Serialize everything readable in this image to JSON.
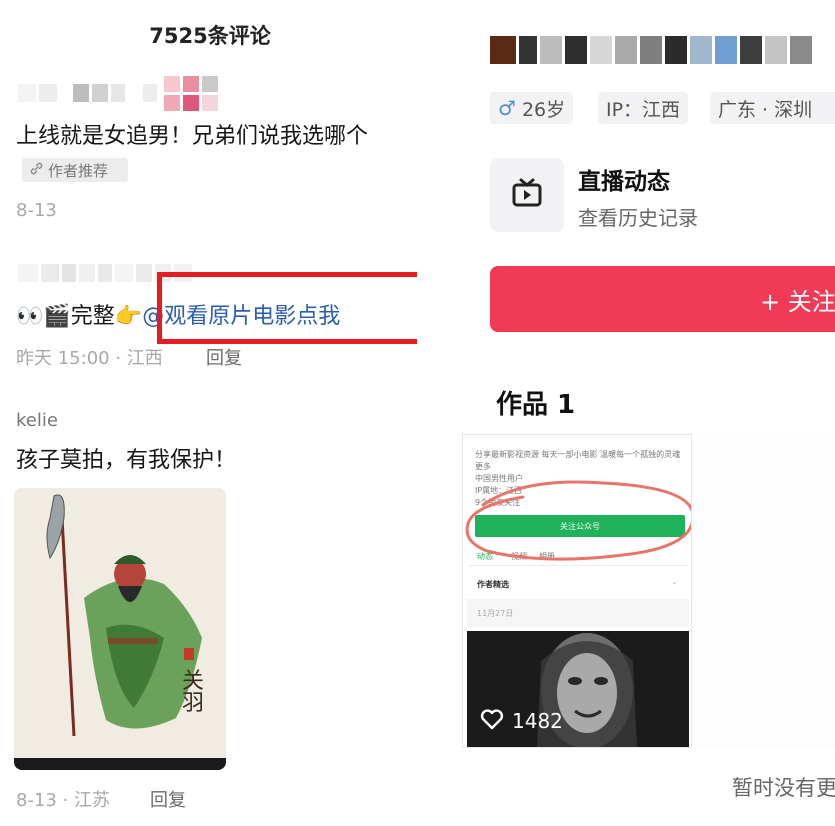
{
  "left": {
    "comment_count_title": "7525条评论",
    "comments": [
      {
        "text": "上线就是女追男！兄弟们说我选哪个",
        "badge": "作者推荐",
        "meta": "8-13"
      },
      {
        "emoji": "👀🎬",
        "text_prefix": "完整",
        "pointer_emoji": "👉",
        "mention": "@观看原片电影点我",
        "meta": "昨天 15:00 · 江西",
        "reply": "回复"
      },
      {
        "username": "kelie",
        "text": "孩子莫拍，有我保护！",
        "meta": "8-13 · 江苏",
        "reply": "回复"
      }
    ]
  },
  "right": {
    "tags": {
      "gender_age": "26岁",
      "ip": "IP：江西",
      "location": "广东 · 深圳"
    },
    "live": {
      "title": "直播动态",
      "subtitle": "查看历史记录"
    },
    "follow_label": "+ 关注",
    "works_title": "作品 1",
    "thumbnail": {
      "line1": "分享最新影视资源 每天一部小电影 温暖每一个孤独的灵魂",
      "line2": "更多",
      "line3": "中国男性用户",
      "line4": "IP属地：江西",
      "line5": "9个朋友关注",
      "green_button": "关注公众号",
      "tab1": "动态",
      "tab2": "视频",
      "tab3": "相册",
      "section": "作者精选",
      "date": "11月27日",
      "likes": "1482"
    },
    "empty_text": "暂时没有更多了"
  },
  "colors": {
    "follow_red": "#f13a56",
    "highlight_box": "#e51d20",
    "mention_blue": "#2a5db0",
    "annotation_circle": "#e8746a",
    "green_button": "#1fb25a"
  },
  "icons": [
    "link-icon",
    "tv-icon",
    "heart-icon",
    "male-icon"
  ]
}
